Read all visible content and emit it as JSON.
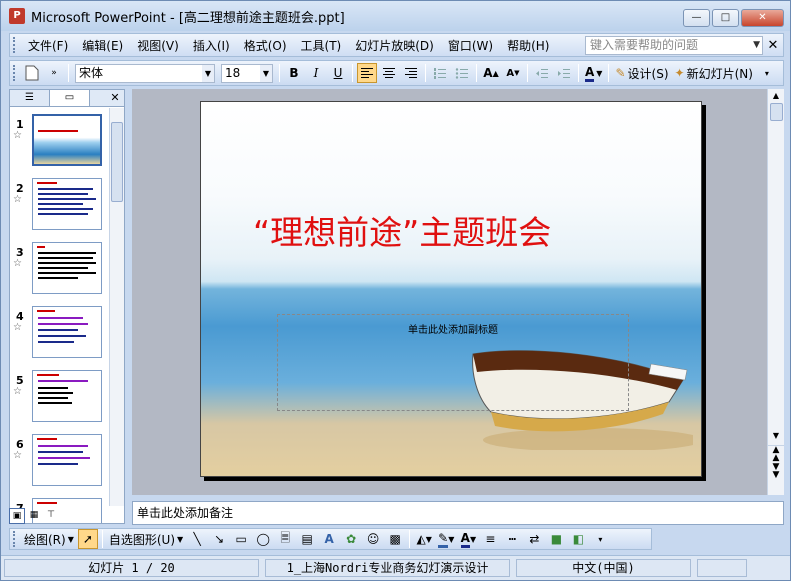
{
  "window": {
    "title": "Microsoft PowerPoint - [高二理想前途主题班会.ppt]",
    "minimize": "—",
    "maximize": "□",
    "close": "✕"
  },
  "menu": {
    "items": [
      "文件(F)",
      "编辑(E)",
      "视图(V)",
      "插入(I)",
      "格式(O)",
      "工具(T)",
      "幻灯片放映(D)",
      "窗口(W)",
      "帮助(H)"
    ],
    "help_placeholder": "键入需要帮助的问题"
  },
  "toolbar": {
    "font": "宋体",
    "size": "18",
    "bold": "B",
    "italic": "I",
    "underline": "U",
    "design": "设计(S)",
    "new_slide": "新幻灯片(N)"
  },
  "slides": {
    "numbers": [
      "1",
      "2",
      "3",
      "4",
      "5",
      "6",
      "7"
    ],
    "selected": 1
  },
  "current_slide": {
    "title": "“理想前途”主题班会",
    "subtitle_placeholder": "单击此处添加副标题"
  },
  "notes": {
    "placeholder": "单击此处添加备注"
  },
  "draw": {
    "draw_label": "绘图(R)",
    "autoshapes_label": "自选图形(U)"
  },
  "status": {
    "slide": "幻灯片 1 / 20",
    "design": "1_上海Nordri专业商务幻灯演示设计",
    "language": "中文(中国)"
  },
  "colors": {
    "title_red": "#e01010",
    "accent": "#3462a8"
  }
}
